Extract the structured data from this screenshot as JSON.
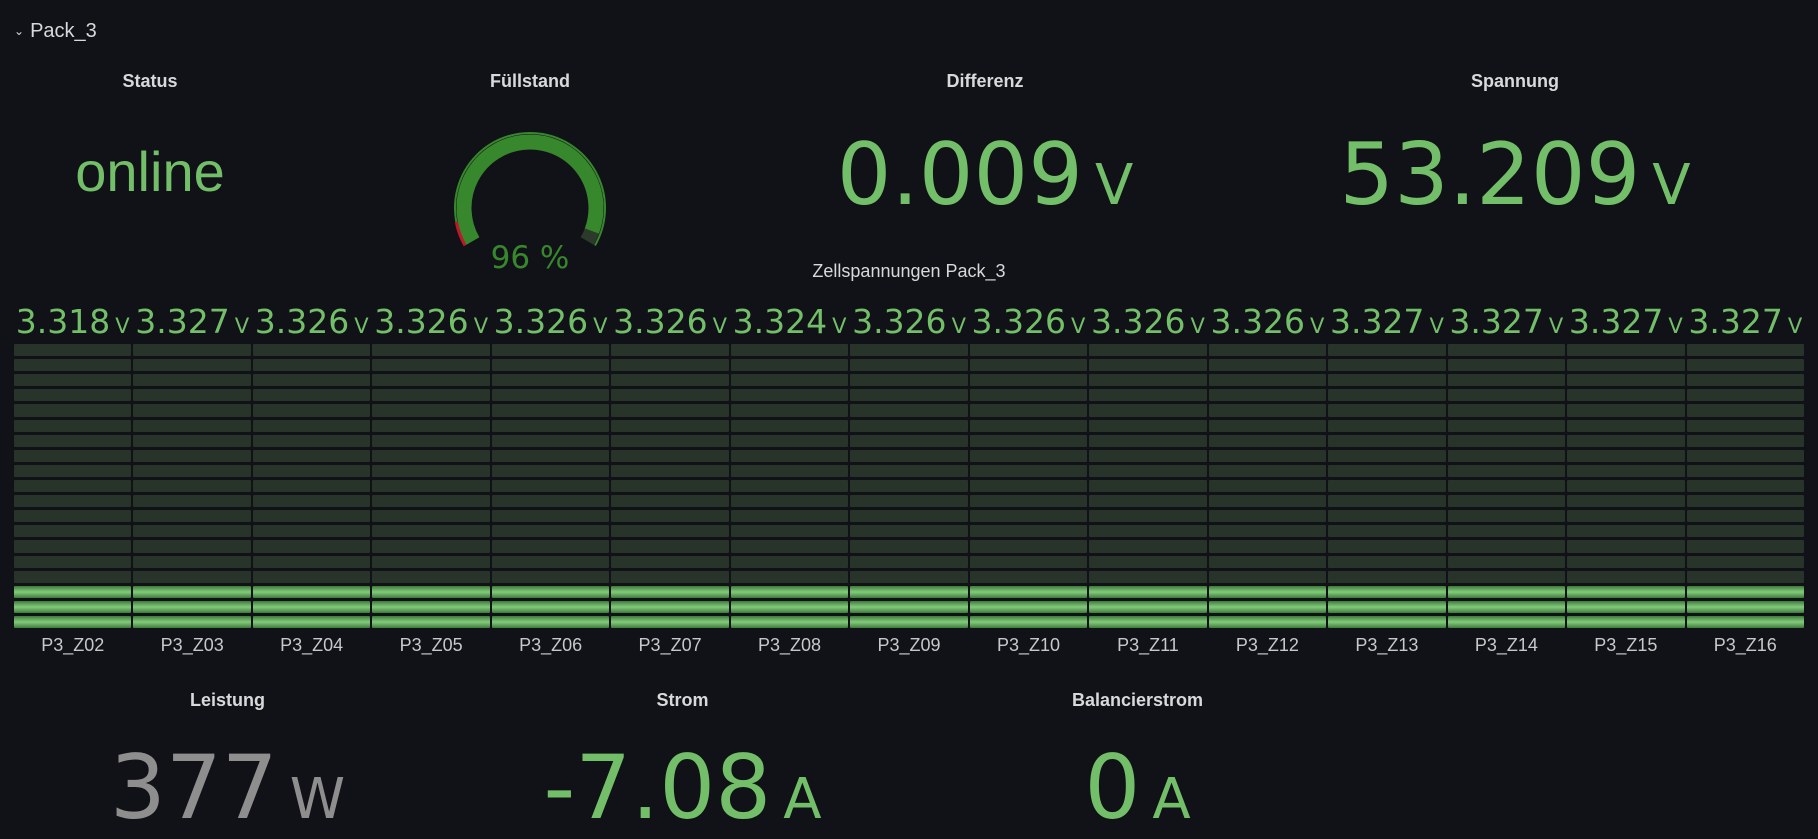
{
  "row": {
    "title": "Pack_3",
    "icon": "chevron-down-icon"
  },
  "colors": {
    "green": "#73bf69",
    "grey": "#8e8e8e",
    "red": "#c4162a",
    "dark_track": "#283329"
  },
  "status": {
    "title": "Status",
    "value": "online"
  },
  "fuellstand": {
    "title": "Füllstand",
    "value": 96,
    "display": "96 %",
    "max": 100
  },
  "differenz": {
    "title": "Differenz",
    "value": "0.009",
    "unit": "V"
  },
  "spannung": {
    "title": "Spannung",
    "value": "53.209",
    "unit": "V"
  },
  "zellen": {
    "title": "Zellspannungen Pack_3",
    "unit": "V",
    "segments_total": 19,
    "segments_lit": 3,
    "cells": [
      {
        "name": "P3_Z02",
        "value": "3.318"
      },
      {
        "name": "P3_Z03",
        "value": "3.327"
      },
      {
        "name": "P3_Z04",
        "value": "3.326"
      },
      {
        "name": "P3_Z05",
        "value": "3.326"
      },
      {
        "name": "P3_Z06",
        "value": "3.326"
      },
      {
        "name": "P3_Z07",
        "value": "3.326"
      },
      {
        "name": "P3_Z08",
        "value": "3.324"
      },
      {
        "name": "P3_Z09",
        "value": "3.326"
      },
      {
        "name": "P3_Z10",
        "value": "3.326"
      },
      {
        "name": "P3_Z11",
        "value": "3.326"
      },
      {
        "name": "P3_Z12",
        "value": "3.326"
      },
      {
        "name": "P3_Z13",
        "value": "3.327"
      },
      {
        "name": "P3_Z14",
        "value": "3.327"
      },
      {
        "name": "P3_Z15",
        "value": "3.327"
      },
      {
        "name": "P3_Z16",
        "value": "3.327"
      }
    ]
  },
  "leistung": {
    "title": "Leistung",
    "value": "377",
    "unit": "W"
  },
  "strom": {
    "title": "Strom",
    "value": "-7.08",
    "unit": "A"
  },
  "balancierstrom": {
    "title": "Balancierstrom",
    "value": "0",
    "unit": "A"
  }
}
